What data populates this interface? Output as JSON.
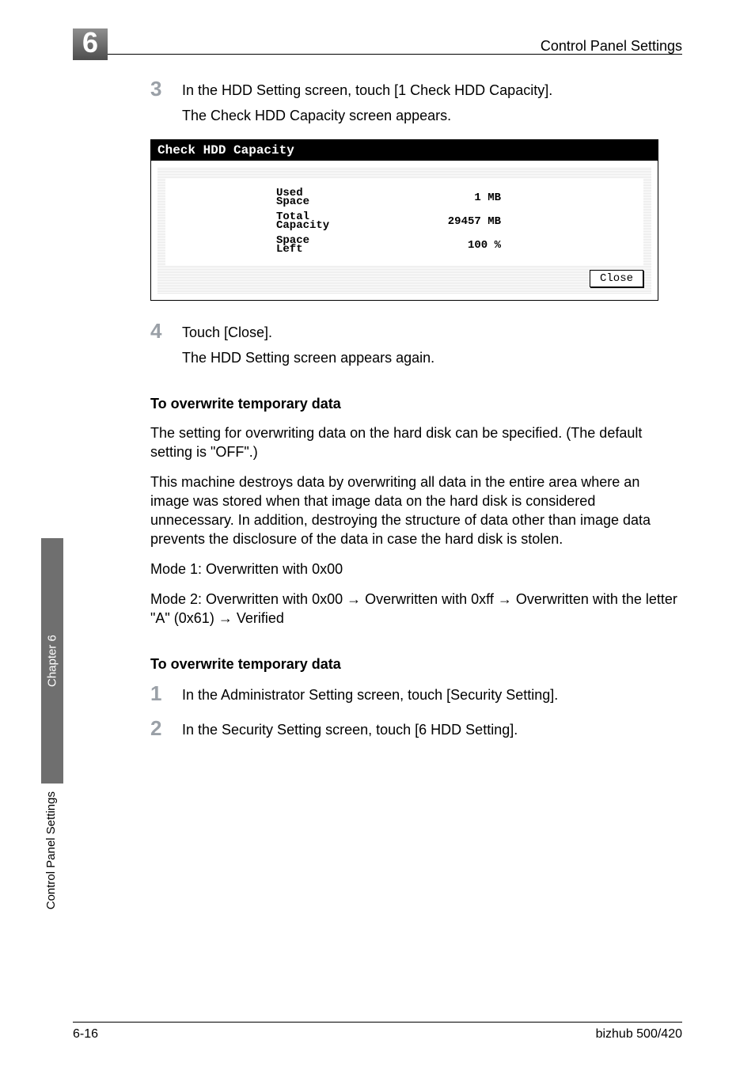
{
  "header": {
    "chapter_num": "6",
    "title": "Control Panel Settings"
  },
  "steps_a": {
    "s3": {
      "num": "3",
      "text": "In the HDD Setting screen, touch [1 Check HDD Capacity].",
      "sub": "The Check HDD Capacity screen appears."
    },
    "s4": {
      "num": "4",
      "text": "Touch [Close].",
      "sub": "The HDD Setting screen appears again."
    }
  },
  "panel": {
    "title": "Check HDD Capacity",
    "rows": {
      "used": {
        "label": "Used\nSpace",
        "value": "1 MB"
      },
      "total": {
        "label": "Total\nCapacity",
        "value": "29457 MB"
      },
      "space": {
        "label": "Space\nLeft",
        "value": "100 %"
      }
    },
    "close_label": "Close"
  },
  "sections": {
    "heading1": "To overwrite temporary data",
    "para1": "The setting for overwriting data on the hard disk can be specified. (The default setting is \"OFF\".)",
    "para2": "This machine destroys data by overwriting all data in the entire area where an image was stored when that image data on the hard disk is considered unnecessary. In addition, destroying the structure of data other than image data prevents the disclosure of the data in case the hard disk is stolen.",
    "mode1": "Mode 1: Overwritten with 0x00",
    "mode2_pre": "Mode 2: Overwritten with 0x00 ",
    "mode2_mid1": " Overwritten with 0xff ",
    "mode2_mid2": " Overwritten with the letter \"A\" (0x61) ",
    "mode2_end": " Verified",
    "heading2": "To overwrite temporary data"
  },
  "steps_b": {
    "s1": {
      "num": "1",
      "text": "In the Administrator Setting screen, touch [Security Setting]."
    },
    "s2": {
      "num": "2",
      "text": "In the Security Setting screen, touch [6 HDD Setting]."
    }
  },
  "side": {
    "tab": "Chapter 6",
    "label": "Control Panel Settings"
  },
  "footer": {
    "left": "6-16",
    "right": "bizhub 500/420"
  }
}
